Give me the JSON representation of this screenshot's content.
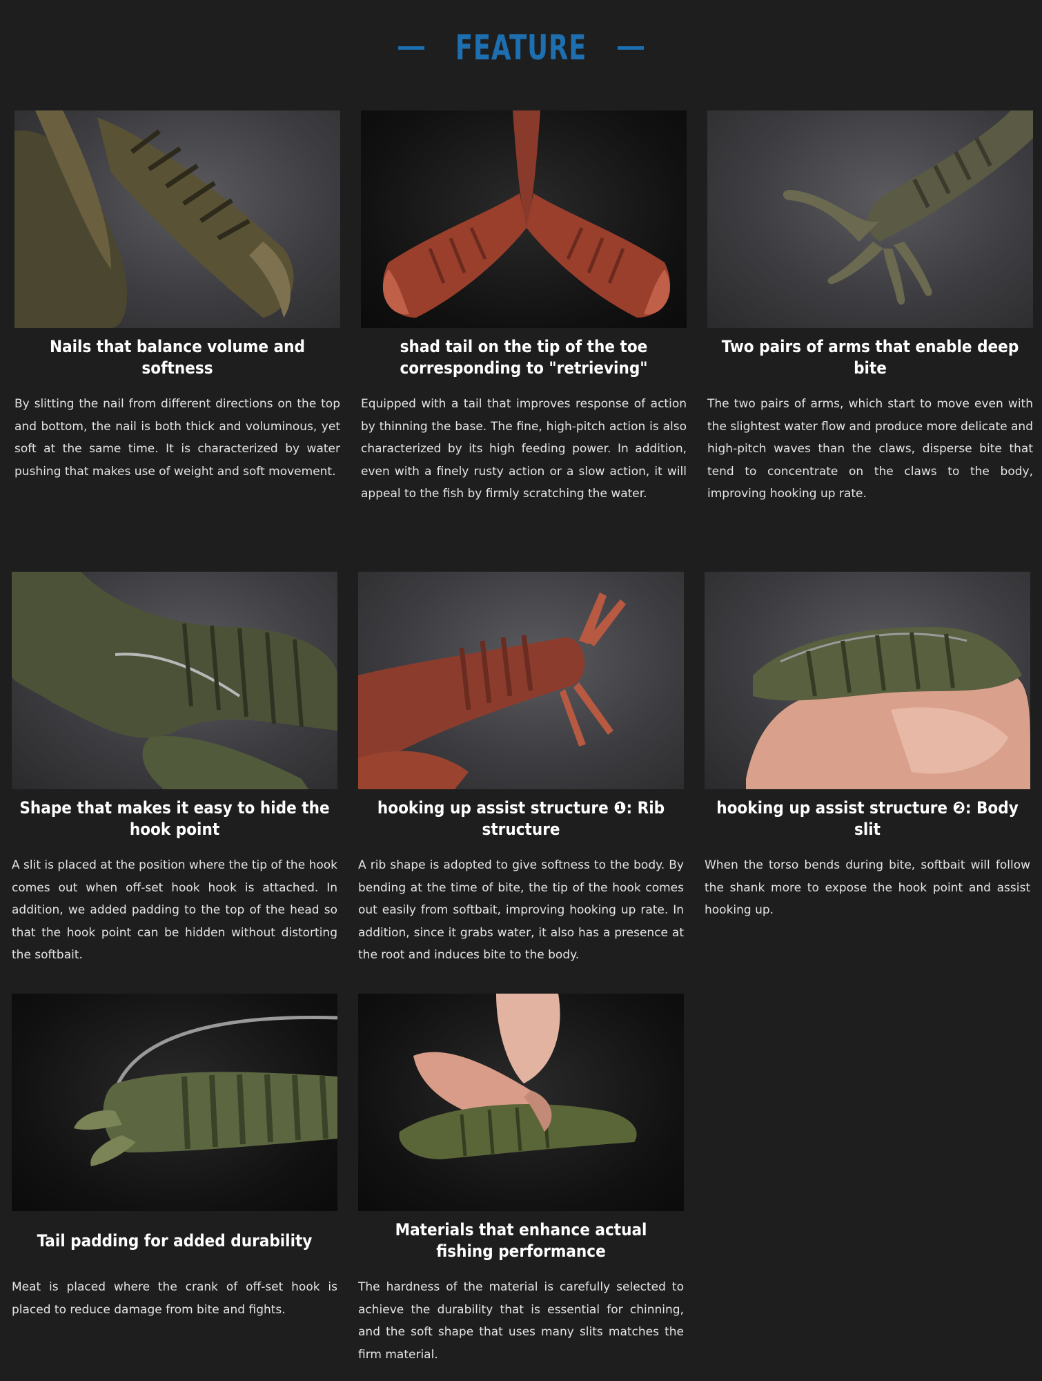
{
  "header": {
    "title": "FEATURE"
  },
  "colors": {
    "accent": "#1d6fb0",
    "background": "#1e1e1f",
    "text": "#ffffff"
  },
  "features": [
    {
      "title": "Nails that balance volume and softness",
      "text": "By slitting the nail from different directions on the top and bottom, the nail is both thick and voluminous, yet soft at the same time. It is characterized by water pushing that makes use of weight and soft movement.",
      "image": "olive-claw-closeup-photo"
    },
    {
      "title": "shad tail on the tip of the toe corresponding to \"retrieving\"",
      "text": "Equipped with a tail that improves response of action by thinning the base. The fine, high-pitch action is also characterized by its high feeding power. In addition, even with a finely rusty action or a slow action, it will appeal to the fish by firmly scratching the water.",
      "image": "red-claws-photo"
    },
    {
      "title": "Two pairs of arms that enable deep bite",
      "text": "The two pairs of arms, which start to move even with the slightest water flow and produce more delicate and high-pitch waves than the claws, disperse bite that tend to concentrate on the claws to the body, improving hooking up rate.",
      "image": "olive-arms-photo"
    },
    {
      "title": "Shape that makes it easy to hide the hook point",
      "text": "A slit is placed at the position where the tip of the hook comes out when off-set hook hook is attached. In addition, we added padding to the top of the head so that the hook point can be hidden without distorting the softbait.",
      "image": "green-claw-hook-photo"
    },
    {
      "title": "hooking up assist structure ❶: Rib structure",
      "text": "A rib shape is adopted to give softness to the body. By bending at the time of bite, the tip of the hook comes out easily from softbait, improving hooking up rate. In addition, since it grabs water, it also has a presence at the root and induces bite to the body.",
      "image": "red-ribs-photo"
    },
    {
      "title": "hooking up assist structure ❷: Body slit",
      "text": "When the torso bends during bite, softbait will follow the shank more to expose the hook point and assist hooking up.",
      "image": "fingers-bending-bait-photo"
    },
    {
      "title": "Tail padding for added durability",
      "text": "Meat is placed where the crank of off-set hook is placed to reduce damage from bite and fights.",
      "image": "rigged-bait-photo"
    },
    {
      "title": "Materials that enhance actual fishing performance",
      "text": "The hardness of the material is carefully selected to achieve the durability that is essential for chinning, and the soft shape that uses many slits matches the firm material.",
      "image": "fingers-pinching-bait-photo"
    }
  ]
}
